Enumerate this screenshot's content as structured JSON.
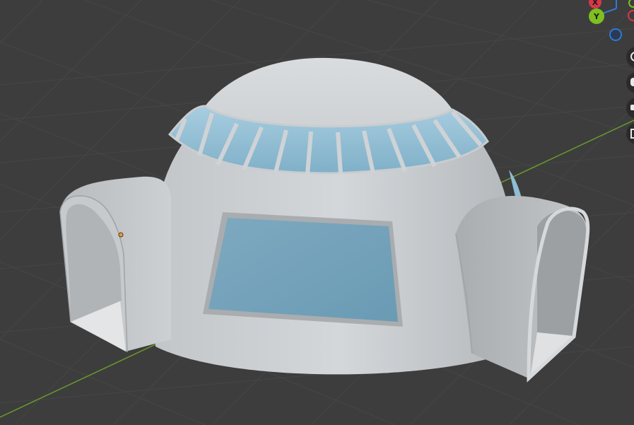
{
  "viewport": {
    "background_color": "#3d3d3d",
    "grid_line_color": "#454545",
    "x_axis_line_color": "#b84a52",
    "y_axis_line_color": "#6b9a2b"
  },
  "gizmo": {
    "x_label": "X",
    "y_label": "Y",
    "z_label": "",
    "x_color": "#d9364a",
    "y_color": "#7fbf1f",
    "z_color": "#2f78d6"
  },
  "scene_object": {
    "name": "igloo-dome-model",
    "shell_color": "#c9cdd0",
    "glass_color": "#8fbdd6",
    "origin_marker_color": "#e89a3a"
  },
  "navigation": {
    "buttons": [
      "zoom-icon",
      "hand-pan-icon",
      "camera-icon",
      "grid-icon"
    ]
  }
}
